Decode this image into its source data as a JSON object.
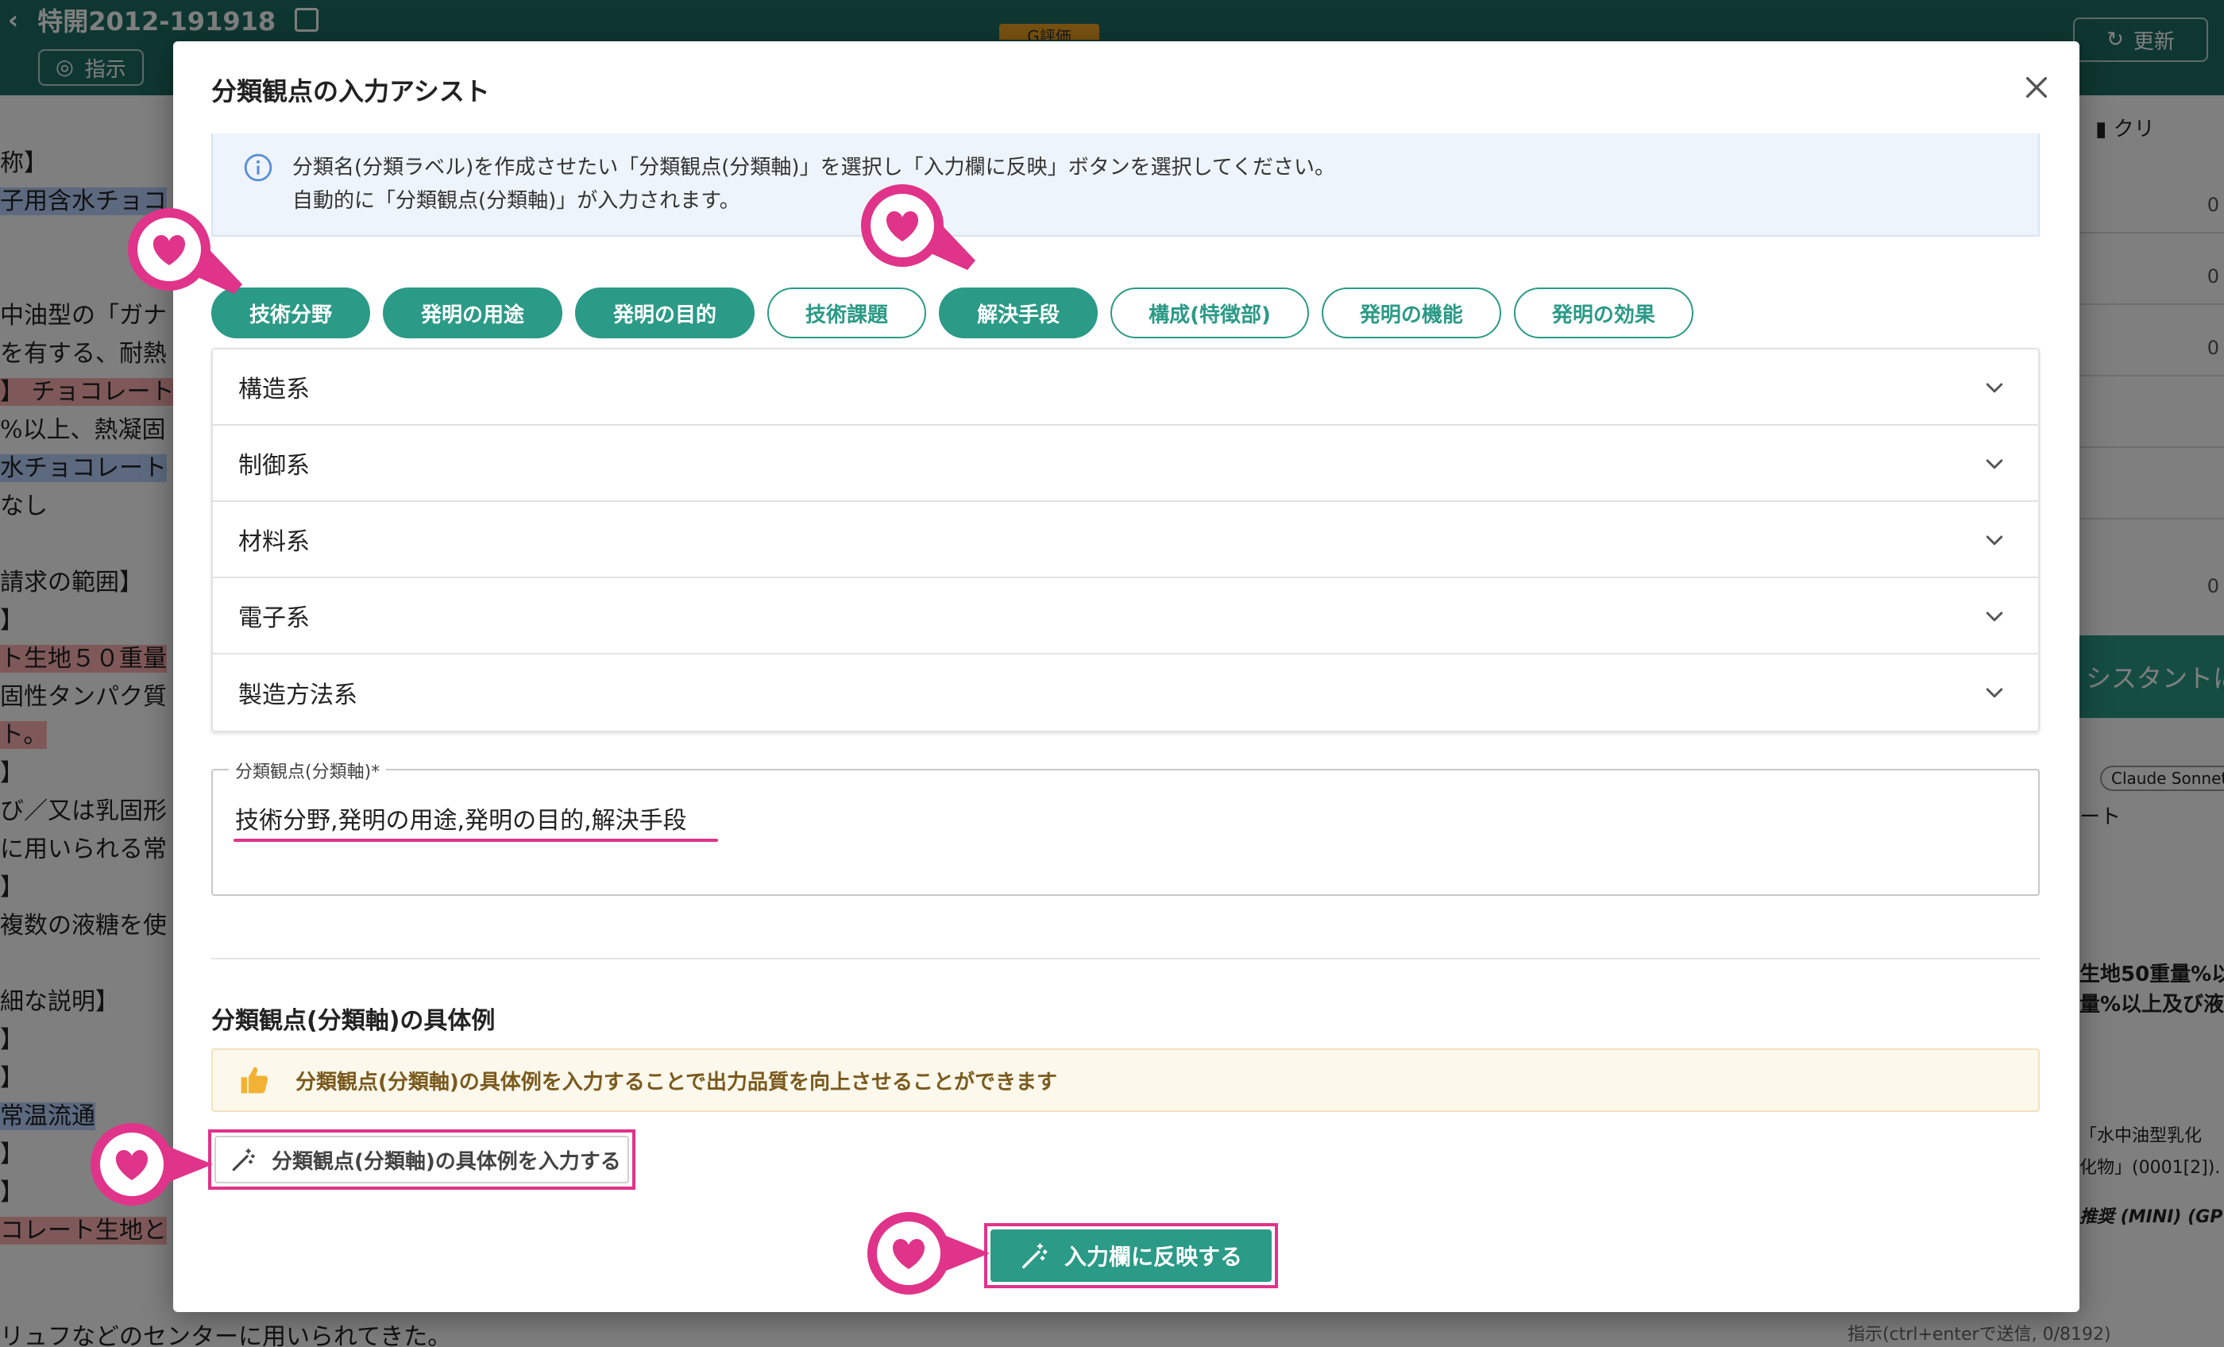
{
  "background": {
    "doc_title": "特開2012-191918",
    "instruction_button": "指示",
    "update_button": "更新",
    "badge": "G評価",
    "left_text": [
      {
        "text": "称】",
        "style": ""
      },
      {
        "text": "子用含水チョコ",
        "style": "b"
      },
      {
        "text": "",
        "style": ""
      },
      {
        "text": "",
        "style": ""
      },
      {
        "text": "中油型の「ガナ",
        "style": ""
      },
      {
        "text": "を有する、耐熱",
        "style": ""
      },
      {
        "text": "】 チョコレート",
        "style": "r"
      },
      {
        "text": "%以上、熱凝固",
        "style": ""
      },
      {
        "text": "水チョコレート",
        "style": "b"
      },
      {
        "text": "なし",
        "style": ""
      },
      {
        "text": "",
        "style": ""
      },
      {
        "text": "請求の範囲】",
        "style": ""
      },
      {
        "text": "】",
        "style": ""
      },
      {
        "text": "ト生地５０重量",
        "style": "r"
      },
      {
        "text": "固性タンパク質",
        "style": ""
      },
      {
        "text": "ト。",
        "style": "r"
      },
      {
        "text": "】",
        "style": ""
      },
      {
        "text": "び／又は乳固形",
        "style": ""
      },
      {
        "text": "に用いられる常",
        "style": ""
      },
      {
        "text": "】",
        "style": ""
      },
      {
        "text": "複数の液糖を使",
        "style": ""
      },
      {
        "text": "",
        "style": ""
      },
      {
        "text": "細な説明】",
        "style": ""
      },
      {
        "text": "】",
        "style": ""
      },
      {
        "text": "】",
        "style": ""
      },
      {
        "text": "常温流通",
        "style": "b"
      },
      {
        "text": "】",
        "style": ""
      },
      {
        "text": "】",
        "style": ""
      },
      {
        "text": "コレート生地と",
        "style": "r"
      }
    ],
    "bottom_text": "リュフなどのセンターに用いられてきた。",
    "right_green_label": "シスタントに指",
    "right_chip": "Claude Sonnet",
    "right_text_1": "ート",
    "right_text_2": "生地50重量%以",
    "right_text_3": "量%以上及び液",
    "right_text_4": "「水中油型乳化",
    "right_text_5": "化物」(0001[2]).",
    "right_text_6": "推奨 (MINI) (GP",
    "right_footer": "指示(ctrl+enterで送信, 0/8192)",
    "right_top": "クリ"
  },
  "modal": {
    "title": "分類観点の入力アシスト",
    "info_line1": "分類名(分類ラベル)を作成させたい「分類観点(分類軸)」を選択し「入力欄に反映」ボタンを選択してください。",
    "info_line2": "自動的に「分類観点(分類軸)」が入力されます。",
    "chips": [
      {
        "label": "技術分野",
        "active": true
      },
      {
        "label": "発明の用途",
        "active": true
      },
      {
        "label": "発明の目的",
        "active": true
      },
      {
        "label": "技術課題",
        "active": false
      },
      {
        "label": "解決手段",
        "active": true
      },
      {
        "label": "構成(特徴部)",
        "active": false
      },
      {
        "label": "発明の機能",
        "active": false
      },
      {
        "label": "発明の効果",
        "active": false
      }
    ],
    "accordion": [
      "構造系",
      "制御系",
      "材料系",
      "電子系",
      "製造方法系"
    ],
    "field_label": "分類観点(分類軸)*",
    "field_value": "技術分野,発明の用途,発明の目的,解決手段",
    "examples_title": "分類観点(分類軸)の具体例",
    "tip_text": "分類観点(分類軸)の具体例を入力することで出力品質を向上させることができます",
    "example_button": "分類観点(分類軸)の具体例を入力する",
    "apply_button": "入力欄に反映する"
  },
  "colors": {
    "accent": "#2b9a87",
    "highlight": "#e0338a"
  }
}
